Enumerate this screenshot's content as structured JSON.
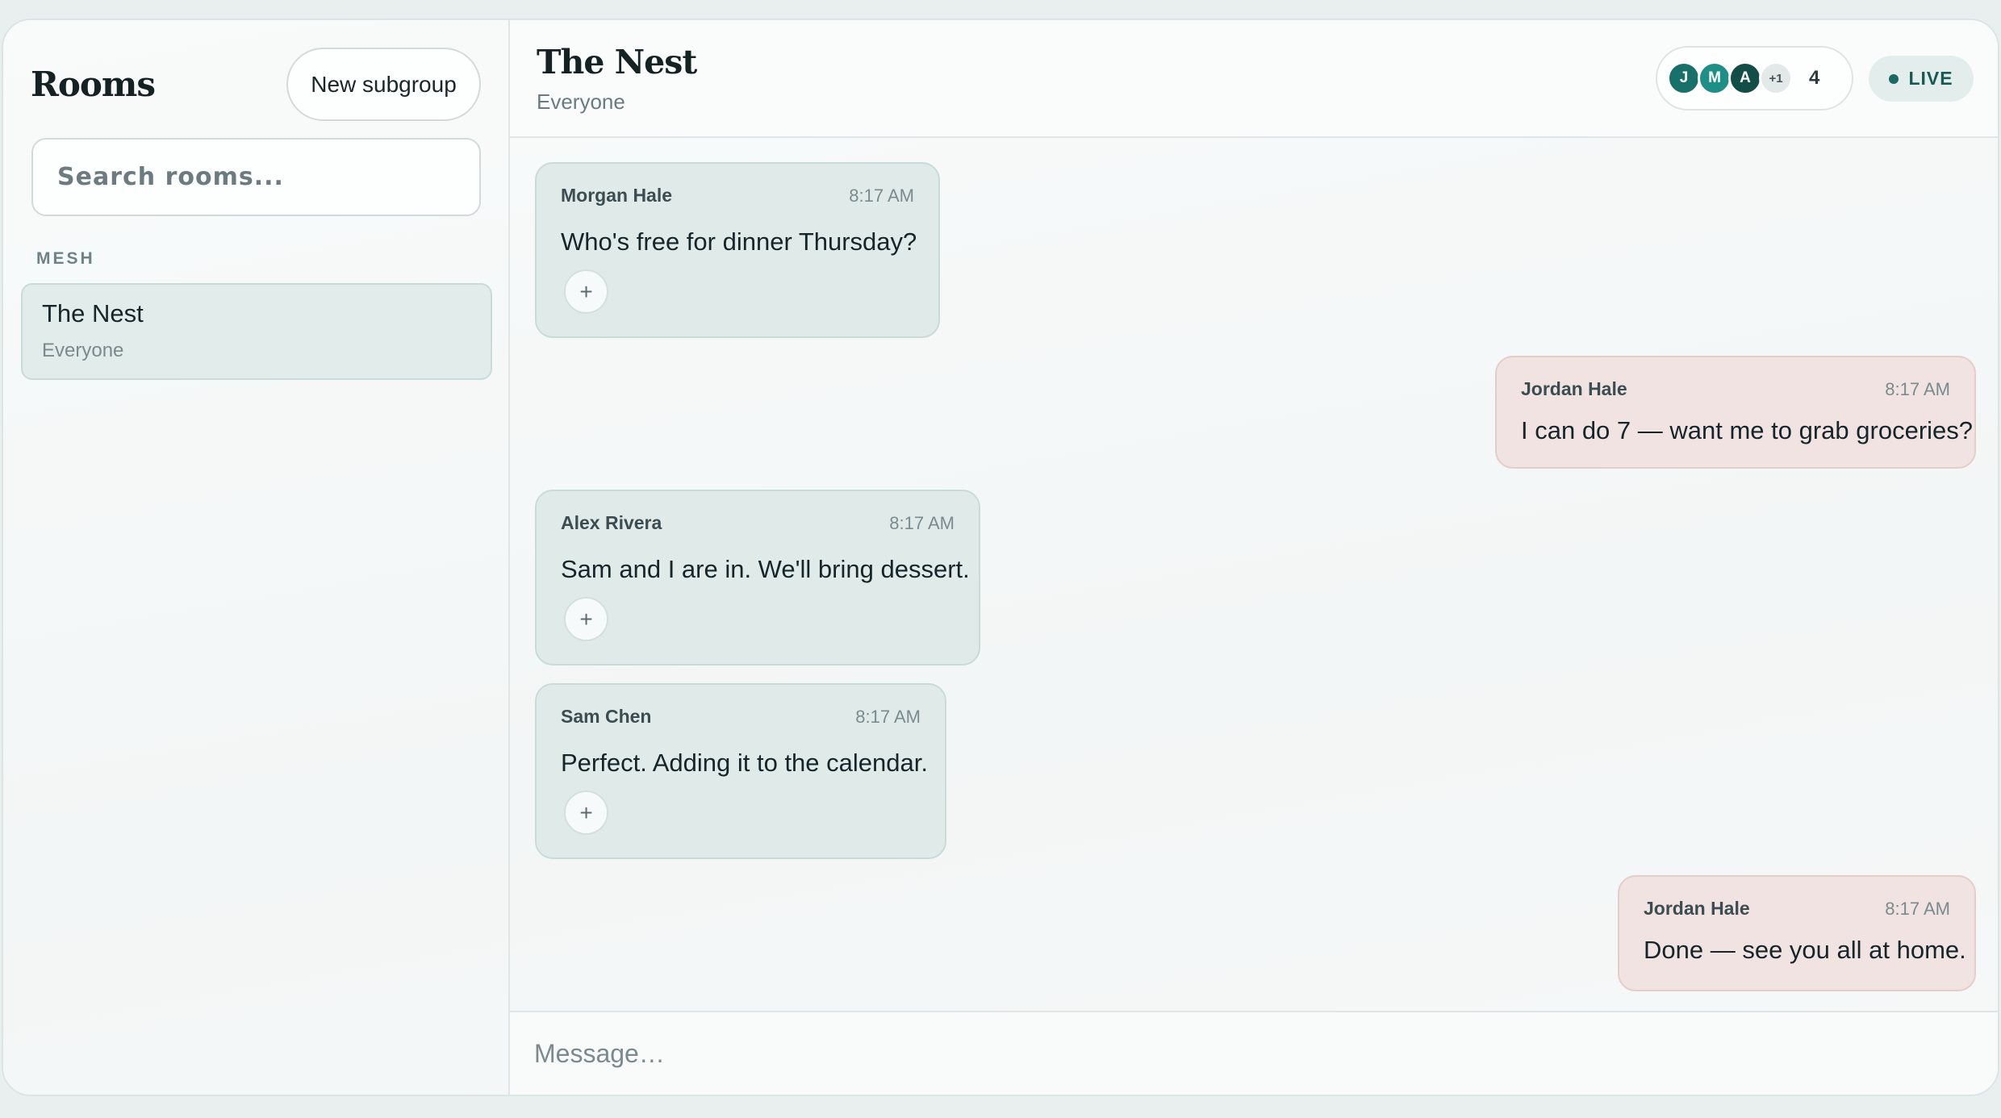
{
  "sidebar": {
    "title": "Rooms",
    "new_button": "New subgroup",
    "search_placeholder": "Search rooms...",
    "section_label": "MESH",
    "rooms": [
      {
        "name": "The Nest",
        "subtitle": "Everyone"
      }
    ]
  },
  "header": {
    "title": "The Nest",
    "subtitle": "Everyone",
    "avatars": [
      "J",
      "M",
      "A"
    ],
    "avatars_more": "+1",
    "member_count": "4",
    "live_label": "LIVE"
  },
  "messages": [
    {
      "author": "Morgan Hale",
      "time": "8:17 AM",
      "text": "Who's free for dinner Thursday?",
      "mine": false,
      "react": "+"
    },
    {
      "author": "Jordan Hale",
      "time": "8:17 AM",
      "text": "I can do 7 — want me to grab groceries?",
      "mine": true
    },
    {
      "author": "Alex Rivera",
      "time": "8:17 AM",
      "text": "Sam and I are in. We'll bring dessert.",
      "mine": false,
      "react": "+"
    },
    {
      "author": "Sam Chen",
      "time": "8:17 AM",
      "text": "Perfect. Adding it to the calendar.",
      "mine": false,
      "react": "+"
    },
    {
      "author": "Jordan Hale",
      "time": "8:17 AM",
      "text": "Done — see you all at home.",
      "mine": true
    }
  ],
  "composer": {
    "placeholder": "Message…"
  },
  "colors": {
    "accent": "#17706a",
    "other_bubble": "#e0ebe9",
    "my_bubble": "#f1e3e1"
  }
}
